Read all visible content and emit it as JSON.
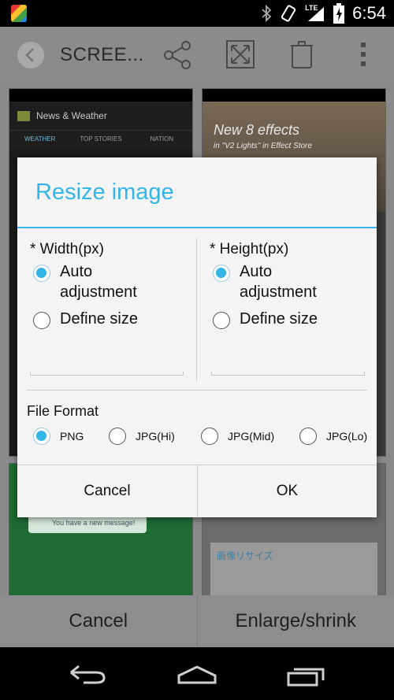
{
  "status_bar": {
    "time": "6:54",
    "network": "LTE"
  },
  "app_bar": {
    "title": "SCREE..."
  },
  "background": {
    "thumb1": {
      "app_title": "News & Weather",
      "tabs": [
        "WEATHER",
        "TOP STORIES",
        "NATION"
      ]
    },
    "thumb2": {
      "headline": "New 8 effects",
      "subline": "in \"V2 Lights\" in Effect Store"
    },
    "thumb3": {
      "message": "You have a new message!"
    },
    "thumb4": {
      "title": "画像リサイズ"
    }
  },
  "dialog": {
    "title": "Resize image",
    "width": {
      "label": "* Width(px)",
      "options": [
        "Auto adjustment",
        "Define size"
      ],
      "selected": 0
    },
    "height": {
      "label": "* Height(px)",
      "options": [
        "Auto adjustment",
        "Define size"
      ],
      "selected": 0
    },
    "file_format": {
      "label": "File Format",
      "options": [
        "PNG",
        "JPG(Hi)",
        "JPG(Mid)",
        "JPG(Lo)"
      ],
      "selected": 0
    },
    "cancel_label": "Cancel",
    "ok_label": "OK"
  },
  "bottom_actions": {
    "cancel_label": "Cancel",
    "enlarge_label": "Enlarge/shrink"
  },
  "colors": {
    "accent": "#33b5e5"
  }
}
